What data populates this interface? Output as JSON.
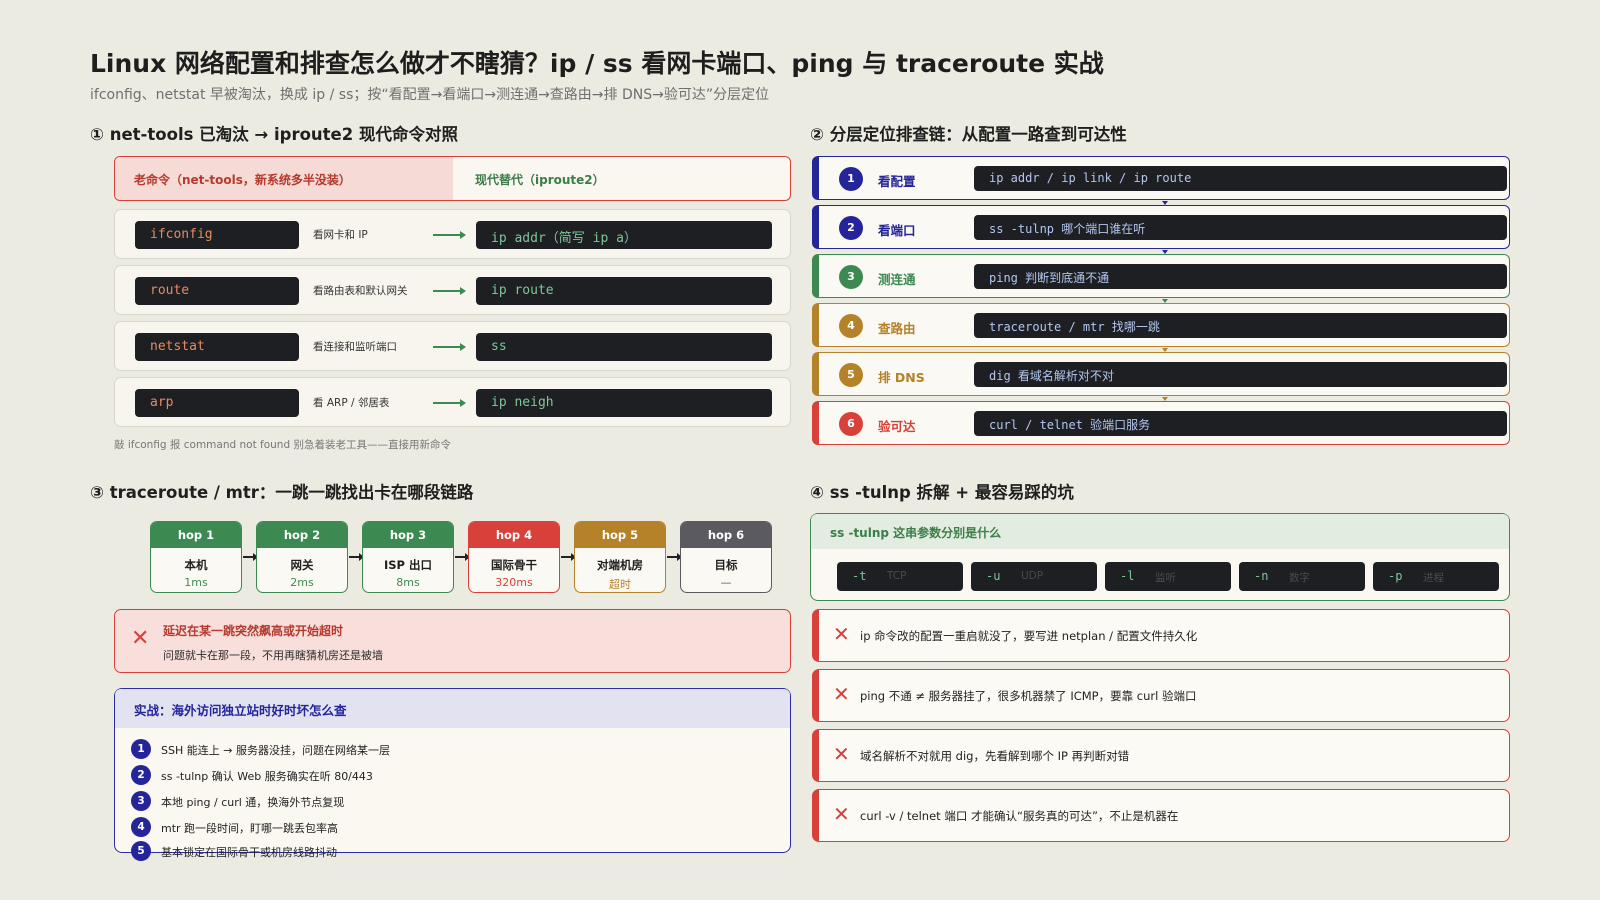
{
  "title": "Linux 网络配置和排查怎么做才不瞎猜？ip / ss 看网卡端口、ping 与 traceroute 实战",
  "subtitle": "ifconfig、netstat 早被淘汰，换成 ip / ss；按“看配置→看端口→测连通→查路由→排 DNS→验可达”分层定位",
  "colors": {
    "red": "#d8403a",
    "green": "#3c8a52",
    "navy": "#25259a",
    "gold": "#b5822a",
    "gray": "#5a5a60"
  },
  "sec1": {
    "heading": "① net-tools 已淘汰 → iproute2 现代命令对照",
    "old_header": "老命令（net-tools，新系统多半没装）",
    "new_header": "现代替代（iproute2）",
    "rows": [
      {
        "old": "ifconfig",
        "desc": "看网卡和 IP",
        "new": "ip addr（简写 ip a）"
      },
      {
        "old": "route",
        "desc": "看路由表和默认网关",
        "new": "ip route"
      },
      {
        "old": "netstat",
        "desc": "看连接和监听端口",
        "new": "ss"
      },
      {
        "old": "arp",
        "desc": "看 ARP / 邻居表",
        "new": "ip neigh"
      }
    ],
    "note": "敲 ifconfig 报 command not found 别急着装老工具——直接用新命令"
  },
  "sec2": {
    "heading": "② 分层定位排查链：从配置一路查到可达性",
    "steps": [
      {
        "num": "1",
        "label": "看配置",
        "cmd": "ip addr / ip link / ip route",
        "color": "#25259a"
      },
      {
        "num": "2",
        "label": "看端口",
        "cmd": "ss -tulnp 哪个端口谁在听",
        "color": "#25259a"
      },
      {
        "num": "3",
        "label": "测连通",
        "cmd": "ping 判断到底通不通",
        "color": "#3c8a52"
      },
      {
        "num": "4",
        "label": "查路由",
        "cmd": "traceroute / mtr 找哪一跳",
        "color": "#b5822a"
      },
      {
        "num": "5",
        "label": "排 DNS",
        "cmd": "dig 看域名解析对不对",
        "color": "#b5822a"
      },
      {
        "num": "6",
        "label": "验可达",
        "cmd": "curl / telnet 验端口服务",
        "color": "#d8403a"
      }
    ]
  },
  "sec3": {
    "heading": "③ traceroute / mtr：一跳一跳找出卡在哪段链路",
    "hops": [
      {
        "hop": "hop 1",
        "name": "本机",
        "latency": "1ms",
        "color": "#3c8a52"
      },
      {
        "hop": "hop 2",
        "name": "网关",
        "latency": "2ms",
        "color": "#3c8a52"
      },
      {
        "hop": "hop 3",
        "name": "ISP 出口",
        "latency": "8ms",
        "color": "#3c8a52"
      },
      {
        "hop": "hop 4",
        "name": "国际骨干",
        "latency": "320ms",
        "color": "#d8403a"
      },
      {
        "hop": "hop 5",
        "name": "对端机房",
        "latency": "超时",
        "color": "#b5822a"
      },
      {
        "hop": "hop 6",
        "name": "目标",
        "latency": "—",
        "color": "#5a5a60"
      }
    ],
    "alert_title": "延迟在某一跳突然飙高或开始超时",
    "alert_text": "问题就卡在那一段，不用再瞎猜机房还是被墙",
    "case_title": "实战：海外访问独立站时好时坏怎么查",
    "case_items": [
      "SSH 能连上 → 服务器没挂，问题在网络某一层",
      "ss -tulnp 确认 Web 服务确实在听 80/443",
      "本地 ping / curl 通，换海外节点复现",
      "mtr 跑一段时间，盯哪一跳丢包率高",
      "基本锁定在国际骨干或机房线路抖动"
    ]
  },
  "sec4": {
    "heading": "④ ss -tulnp 拆解 + 最容易踩的坑",
    "box_title": "ss -tulnp 这串参数分别是什么",
    "flags": [
      {
        "flag": "-t",
        "meaning": "TCP"
      },
      {
        "flag": "-u",
        "meaning": "UDP"
      },
      {
        "flag": "-l",
        "meaning": "监听"
      },
      {
        "flag": "-n",
        "meaning": "数字"
      },
      {
        "flag": "-p",
        "meaning": "进程"
      }
    ],
    "pitfalls": [
      "ip 命令改的配置一重启就没了，要写进 netplan / 配置文件持久化",
      "ping 不通 ≠ 服务器挂了，很多机器禁了 ICMP，要靠 curl 验端口",
      "域名解析不对就用 dig，先看解到哪个 IP 再判断对错",
      "curl -v / telnet 端口 才能确认“服务真的可达”，不止是机器在"
    ]
  }
}
